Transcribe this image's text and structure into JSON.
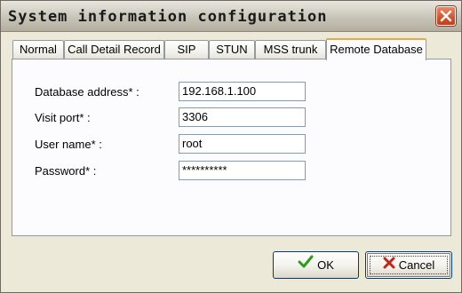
{
  "window": {
    "title": "System information configuration"
  },
  "tabs": [
    {
      "label": "Normal",
      "active": false
    },
    {
      "label": "Call Detail Record",
      "active": false
    },
    {
      "label": "SIP",
      "active": false
    },
    {
      "label": "STUN",
      "active": false
    },
    {
      "label": "MSS trunk",
      "active": false
    },
    {
      "label": "Remote Database",
      "active": true
    }
  ],
  "form": {
    "fields": [
      {
        "label": "Database address* :",
        "value": "192.168.1.100"
      },
      {
        "label": "Visit port* :",
        "value": "3306"
      },
      {
        "label": "User name* :",
        "value": "root"
      },
      {
        "label": "Password* :",
        "value": "**********"
      }
    ]
  },
  "buttons": {
    "ok_label": "OK",
    "cancel_label": "Cancel"
  },
  "icons": {
    "close": "close-icon",
    "ok": "checkmark-icon",
    "cancel": "x-icon"
  },
  "colors": {
    "ok_icon": "#2f9a1f",
    "cancel_icon": "#c0241a",
    "close_button": "#d4532c"
  }
}
